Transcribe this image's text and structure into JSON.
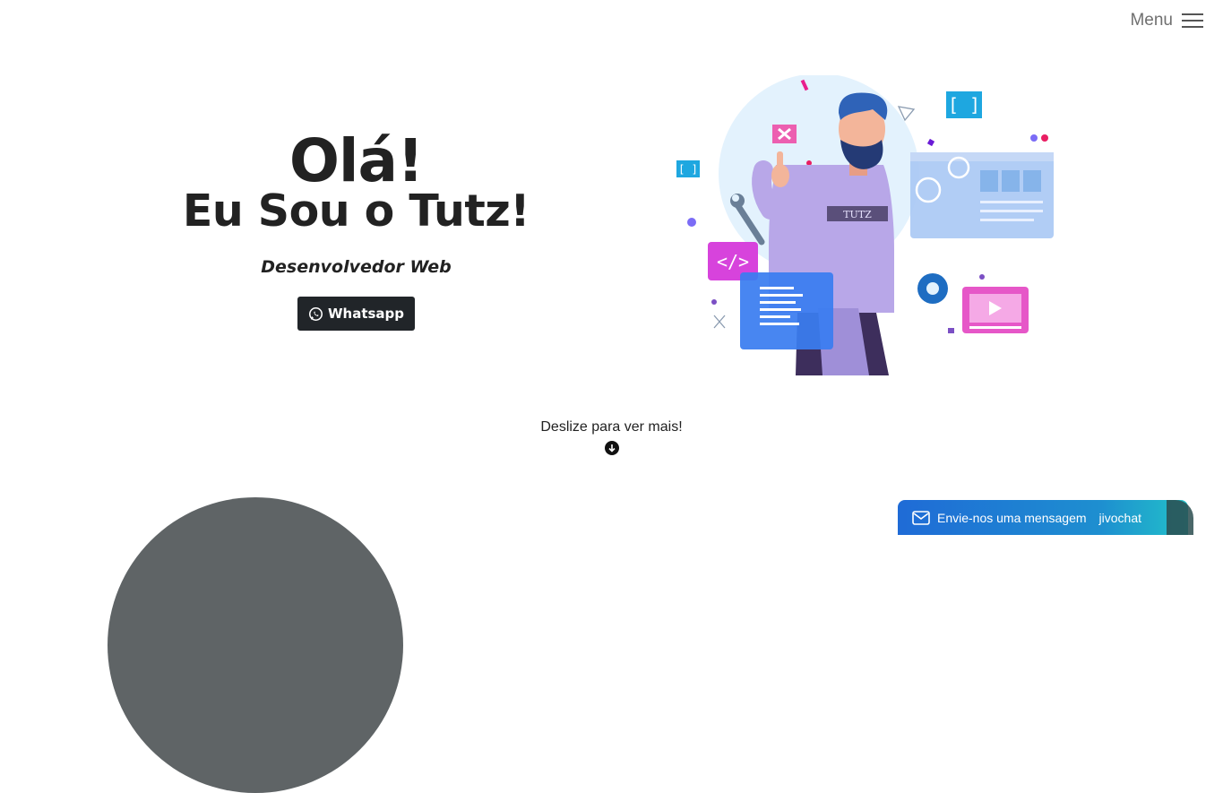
{
  "nav": {
    "menu_label": "Menu"
  },
  "hero": {
    "greeting": "Olá!",
    "name_line": "Eu Sou o Tutz!",
    "role": "Desenvolvedor Web",
    "whatsapp_label": "Whatsapp"
  },
  "illustration": {
    "shirt_text": "TUTZ"
  },
  "scroll": {
    "hint": "Deslize para ver mais!"
  },
  "chat": {
    "message": "Envie-nos uma mensagem",
    "brand": "jivochat"
  },
  "colors": {
    "dark": "#212529",
    "accent_blue": "#1f6bd6",
    "accent_teal": "#22c1c9",
    "grey_shape": "#5f6466"
  }
}
